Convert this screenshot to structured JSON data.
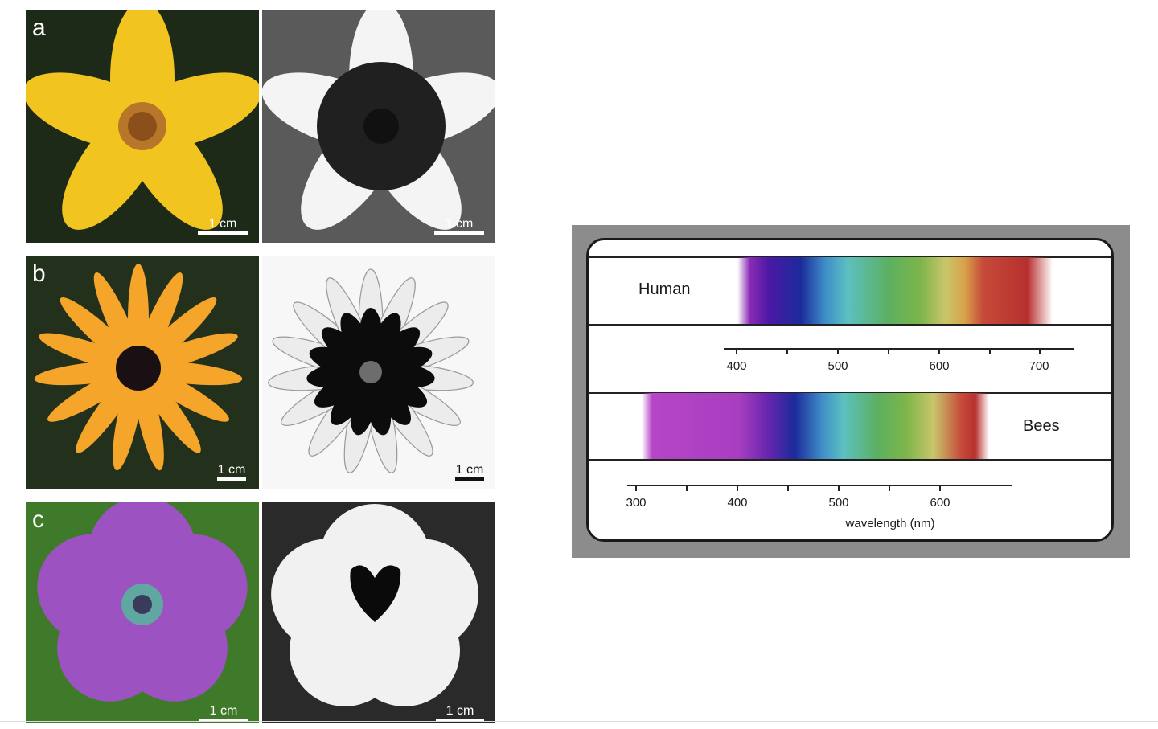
{
  "panels": [
    {
      "letter": "a",
      "left_scale": "1 cm",
      "right_scale": "1 cm"
    },
    {
      "letter": "b",
      "left_scale": "1 cm",
      "right_scale": "1 cm"
    },
    {
      "letter": "c",
      "left_scale": "1 cm",
      "right_scale": "1 cm"
    }
  ],
  "spectrum": {
    "human_label": "Human",
    "bees_label": "Bees",
    "human_ticks": [
      "400",
      "500",
      "600",
      "700"
    ],
    "bees_ticks": [
      "300",
      "400",
      "500",
      "600"
    ],
    "axis_title": "wavelength (nm)"
  }
}
